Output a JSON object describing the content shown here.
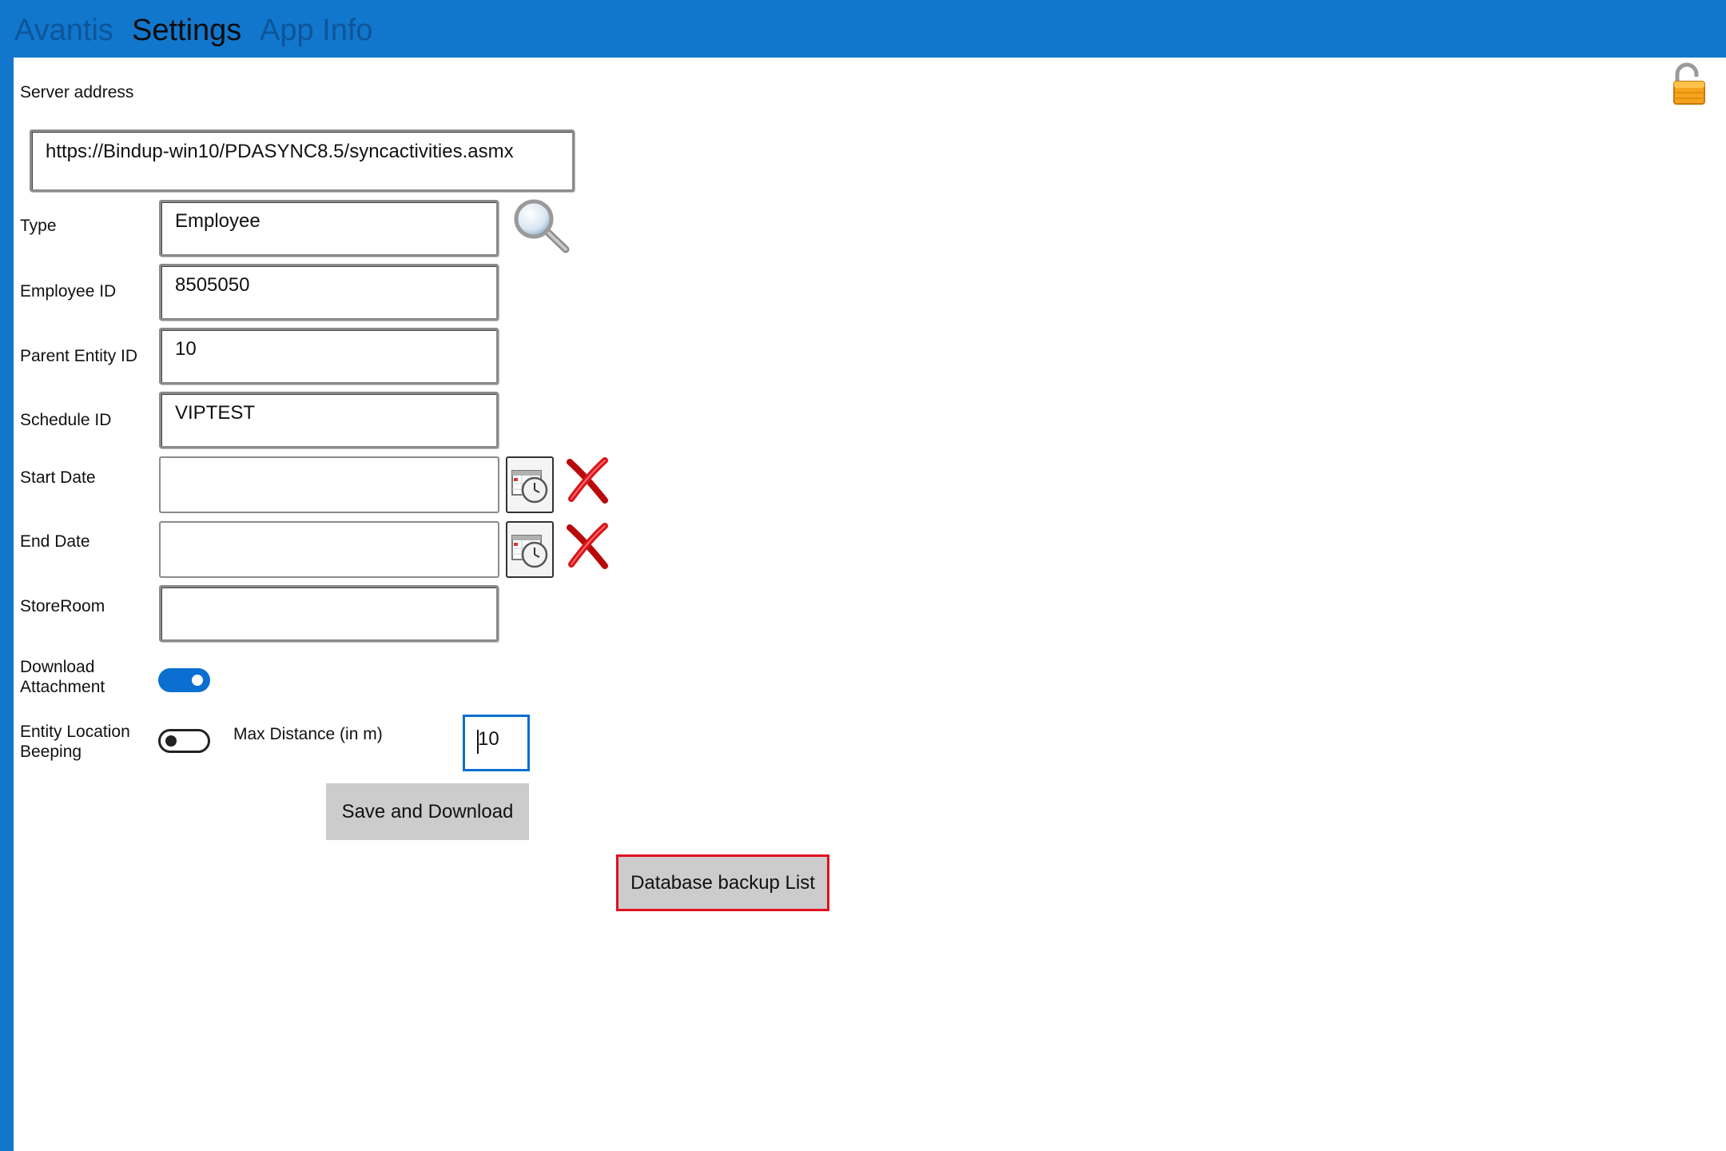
{
  "tabs": [
    {
      "label": "Avantis",
      "active": false
    },
    {
      "label": "Settings",
      "active": true
    },
    {
      "label": "App Info",
      "active": false
    }
  ],
  "form": {
    "server_address": {
      "label": "Server address",
      "value": "https://Bindup-win10/PDASYNC8.5/syncactivities.asmx"
    },
    "type": {
      "label": "Type",
      "value": "Employee"
    },
    "employee_id": {
      "label": "Employee ID",
      "value": "8505050"
    },
    "parent_entity_id": {
      "label": "Parent Entity ID",
      "value": "10"
    },
    "schedule_id": {
      "label": "Schedule ID",
      "value": "VIPTEST"
    },
    "start_date": {
      "label": "Start Date",
      "value": ""
    },
    "end_date": {
      "label": "End Date",
      "value": ""
    },
    "storeroom": {
      "label": "StoreRoom",
      "value": ""
    },
    "download_attachment": {
      "label_line1": "Download",
      "label_line2": "Attachment",
      "on": true
    },
    "entity_location_beeping": {
      "label_line1": "Entity Location",
      "label_line2": "Beeping",
      "on": false
    },
    "max_distance": {
      "label": "Max Distance (in m)",
      "value": "10"
    }
  },
  "buttons": {
    "save_download": "Save and Download",
    "database_backup": "Database backup List"
  },
  "icons": {
    "lock": "unlocked-padlock-icon",
    "search": "magnifier-icon",
    "calendar": "calendar-clock-icon",
    "clear": "red-x-icon"
  },
  "colors": {
    "header_bg": "#1177cc",
    "toggle_on": "#0a6fd1",
    "focus_border": "#0a6fd1",
    "highlight_border": "#e01020",
    "button_bg": "#cccccc"
  }
}
